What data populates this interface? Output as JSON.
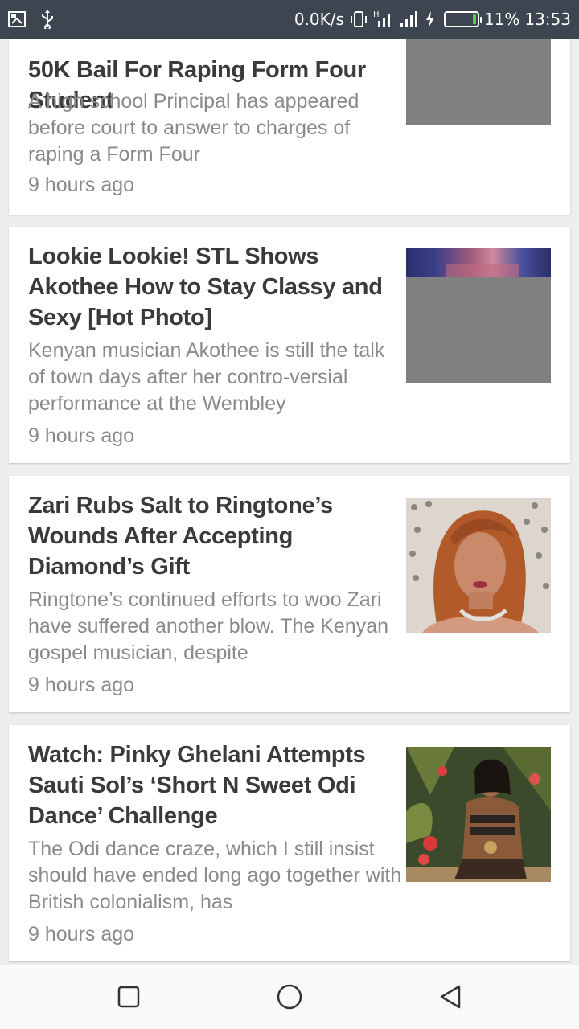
{
  "status_bar": {
    "net_speed": "0.0K/s",
    "battery_percent": "11%",
    "time": "13:53",
    "battery_level": 0.11,
    "icons": [
      "screenshot-icon",
      "usb-icon",
      "vibrate-icon",
      "signal-h-icon",
      "signal-icon",
      "charging-icon",
      "battery-icon"
    ]
  },
  "articles": [
    {
      "title": "50K Bail For Raping Form Four Student",
      "excerpt": "A high school Principal has appeared before court to answer to charges of raping a Form Four",
      "time": "9 hours ago"
    },
    {
      "title": "Lookie Lookie! STL Shows Akothee How to Stay Classy and Sexy [Hot Photo]",
      "excerpt": "Kenyan musician Akothee is still the talk of town days after her contro-versial performance at the Wembley",
      "time": "9 hours ago"
    },
    {
      "title": "Zari Rubs Salt to Ringtone’s Wounds After Accepting Diamond’s Gift",
      "excerpt": "Ringtone’s continued efforts to woo Zari have suffered another blow. The Kenyan gospel musician, despite",
      "time": "9 hours ago"
    },
    {
      "title": "Watch: Pinky Ghelani Attempts Sauti Sol’s ‘Short N Sweet Odi Dance’ Challenge",
      "excerpt": "The Odi dance craze, which I still insist should have ended long ago together with British colonialism, has",
      "time": "9 hours ago"
    }
  ],
  "nav": {
    "icons": [
      "recent-apps-icon",
      "home-icon",
      "back-icon"
    ]
  }
}
